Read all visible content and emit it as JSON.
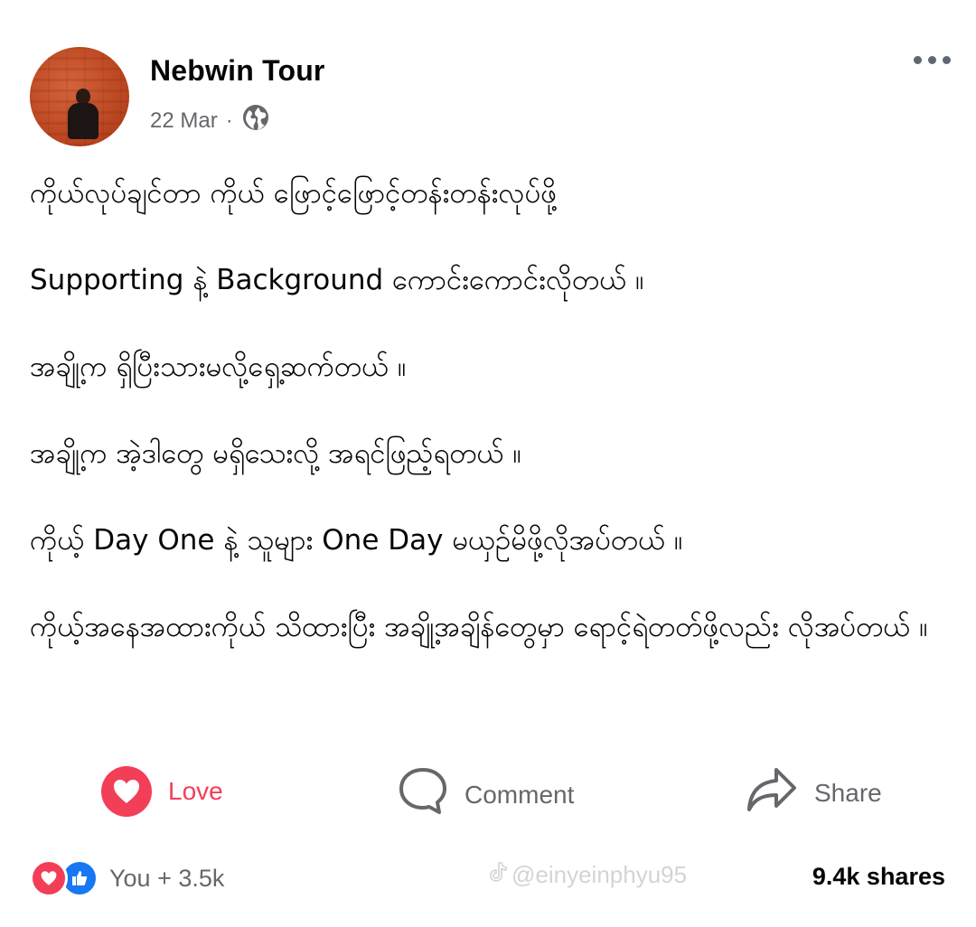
{
  "post": {
    "author": "Nebwin Tour",
    "date": "22 Mar",
    "separator": "·",
    "privacy_icon": "globe-icon",
    "menu_icon": "more-horizontal-icon",
    "paragraphs": [
      "ကိုယ်လုပ်ချင်တာ ကိုယ် ဖြောင့်ဖြောင့်တန်းတန်းလုပ်ဖို့",
      "Supporting နဲ့ Background ကောင်းကောင်းလိုတယ် ။",
      "အချို့က ရှိပြီးသားမလို့ရှေ့ဆက်တယ် ။",
      "အချို့က အဲ့ဒါတွေ မရှိသေးလို့ အရင်ဖြည့်ရတယ် ။",
      "ကိုယ့် Day One  နဲ့ သူများ  One Day မယှဉ်မိဖို့လိုအပ်တယ် ။",
      "ကိုယ့်အနေအထားကိုယ် သိထားပြီး အချို့အချိန်တွေမှာ ရောင့်ရဲတတ်ဖို့လည်း လိုအပ်တယ် ။"
    ]
  },
  "actions": {
    "love_label": "Love",
    "comment_label": "Comment",
    "share_label": "Share"
  },
  "footer": {
    "reactions_text": "You + 3.5k",
    "shares_text": "9.4k shares",
    "watermark": "@einyeinphyu95"
  },
  "colors": {
    "love": "#f33e58",
    "like": "#1877f2",
    "secondary_text": "#65676b"
  }
}
